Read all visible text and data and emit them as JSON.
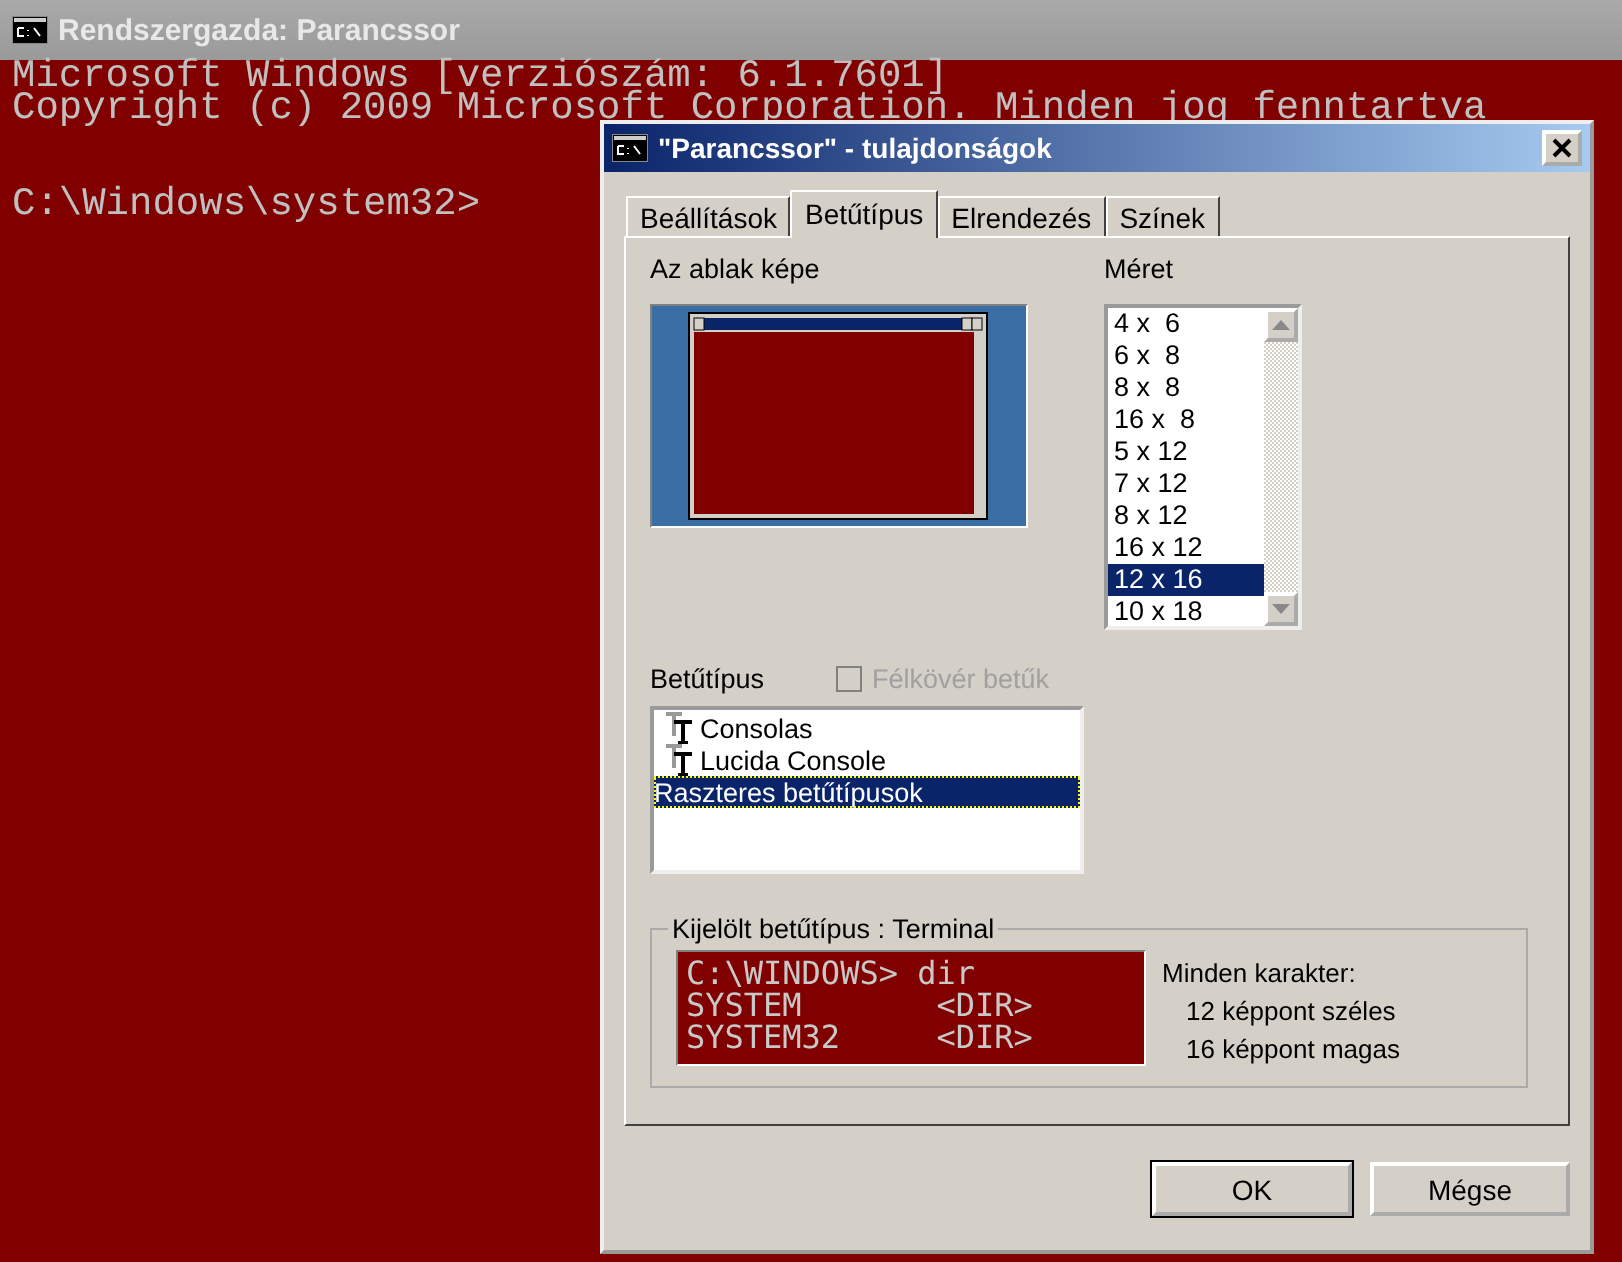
{
  "console": {
    "title": "Rendszergazda: Parancssor",
    "output_lines": [
      "Microsoft Windows [verziószám: 6.1.7601]",
      "Copyright (c) 2009 Microsoft Corporation. Minden jog fenntartva"
    ],
    "prompt": "C:\\Windows\\system32>"
  },
  "dialog": {
    "title": "\"Parancssor\" - tulajdonságok",
    "tabs": [
      {
        "label": "Beállítások",
        "selected": false
      },
      {
        "label": "Betűtípus",
        "selected": true
      },
      {
        "label": "Elrendezés",
        "selected": false
      },
      {
        "label": "Színek",
        "selected": false
      }
    ],
    "window_preview_label": "Az ablak képe",
    "size_label": "Méret",
    "sizes": [
      {
        "label": "4 x  6",
        "selected": false
      },
      {
        "label": "6 x  8",
        "selected": false
      },
      {
        "label": "8 x  8",
        "selected": false
      },
      {
        "label": "16 x  8",
        "selected": false
      },
      {
        "label": "5 x 12",
        "selected": false
      },
      {
        "label": "7 x 12",
        "selected": false
      },
      {
        "label": "8 x 12",
        "selected": false
      },
      {
        "label": "16 x 12",
        "selected": false
      },
      {
        "label": "12 x 16",
        "selected": true
      },
      {
        "label": "10 x 18",
        "selected": false
      }
    ],
    "font_label": "Betűtípus",
    "bold_checkbox": {
      "label": "Félkövér betűk",
      "checked": false,
      "disabled": true
    },
    "fonts": [
      {
        "label": "Consolas",
        "kind": "truetype",
        "selected": false
      },
      {
        "label": "Lucida Console",
        "kind": "truetype",
        "selected": false
      },
      {
        "label": "Raszteres betűtípusok",
        "kind": "raster",
        "selected": true
      }
    ],
    "selected_font": {
      "legend": "Kijelölt betűtípus : Terminal",
      "sample_lines": [
        "C:\\WINDOWS> dir",
        "SYSTEM       <DIR>",
        "SYSTEM32     <DIR>"
      ],
      "info_title": "Minden karakter:",
      "info_lines": [
        "12 képpont széles",
        "16 képpont magas"
      ]
    },
    "buttons": [
      {
        "label": "OK",
        "default": true
      },
      {
        "label": "Mégse",
        "default": false
      }
    ]
  }
}
